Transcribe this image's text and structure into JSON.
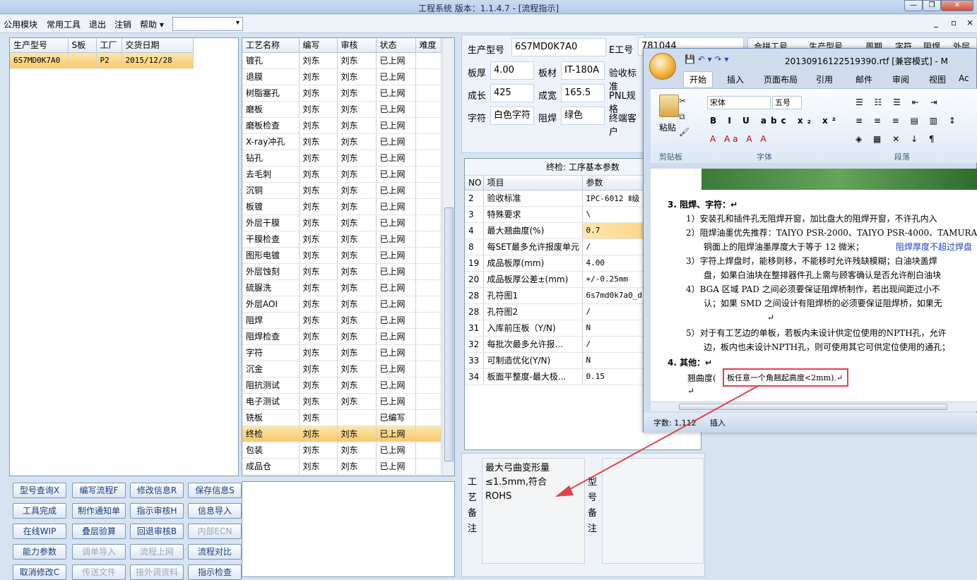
{
  "window": {
    "title": "工程系统  版本：1.1.4.7 - [流程指示]",
    "min": "—",
    "max": "❐",
    "close": "✕",
    "inner_min": "_",
    "inner_max": "▫",
    "inner_close": "×"
  },
  "menu": [
    "公用模块",
    "常用工具",
    "退出",
    "注销",
    "帮助 ▾"
  ],
  "orders": {
    "headers": [
      "生产型号",
      "S板",
      "工厂",
      "交货日期"
    ],
    "rows": [
      [
        "6S7MD0K7A0",
        "",
        "P2",
        "2015/12/28"
      ]
    ]
  },
  "process": {
    "headers": [
      "工艺名称",
      "编写",
      "审核",
      "状态",
      "难度"
    ],
    "rows": [
      [
        "镀孔",
        "刘东",
        "刘东",
        "已上网",
        ""
      ],
      [
        "退膜",
        "刘东",
        "刘东",
        "已上网",
        ""
      ],
      [
        "树脂塞孔",
        "刘东",
        "刘东",
        "已上网",
        ""
      ],
      [
        "磨板",
        "刘东",
        "刘东",
        "已上网",
        ""
      ],
      [
        "磨板检查",
        "刘东",
        "刘东",
        "已上网",
        ""
      ],
      [
        "X-ray冲孔",
        "刘东",
        "刘东",
        "已上网",
        ""
      ],
      [
        "钻孔",
        "刘东",
        "刘东",
        "已上网",
        ""
      ],
      [
        "去毛刺",
        "刘东",
        "刘东",
        "已上网",
        ""
      ],
      [
        "沉铜",
        "刘东",
        "刘东",
        "已上网",
        ""
      ],
      [
        "板镀",
        "刘东",
        "刘东",
        "已上网",
        ""
      ],
      [
        "外层干膜",
        "刘东",
        "刘东",
        "已上网",
        ""
      ],
      [
        "干膜检查",
        "刘东",
        "刘东",
        "已上网",
        ""
      ],
      [
        "图形电镀",
        "刘东",
        "刘东",
        "已上网",
        ""
      ],
      [
        "外层蚀刻",
        "刘东",
        "刘东",
        "已上网",
        ""
      ],
      [
        "硫脲洗",
        "刘东",
        "刘东",
        "已上网",
        ""
      ],
      [
        "外层AOI",
        "刘东",
        "刘东",
        "已上网",
        ""
      ],
      [
        "阻焊",
        "刘东",
        "刘东",
        "已上网",
        ""
      ],
      [
        "阻焊检查",
        "刘东",
        "刘东",
        "已上网",
        ""
      ],
      [
        "字符",
        "刘东",
        "刘东",
        "已上网",
        ""
      ],
      [
        "沉金",
        "刘东",
        "刘东",
        "已上网",
        ""
      ],
      [
        "阻抗测试",
        "刘东",
        "刘东",
        "已上网",
        ""
      ],
      [
        "电子测试",
        "刘东",
        "刘东",
        "已上网",
        ""
      ],
      [
        "铣板",
        "刘东",
        "",
        "已编写",
        ""
      ],
      [
        "终检",
        "刘东",
        "刘东",
        "已上网",
        ""
      ],
      [
        "包装",
        "刘东",
        "刘东",
        "已上网",
        ""
      ],
      [
        "成品仓",
        "刘东",
        "刘东",
        "已上网",
        ""
      ]
    ],
    "selected": 23
  },
  "buttons": [
    [
      "型号查询X",
      "编写流程F",
      "修改信息R",
      "保存信息S"
    ],
    [
      "工具完成",
      "制作通知单",
      "指示审核H",
      "信息导入"
    ],
    [
      "在线WIP",
      "叠层验算",
      "回退审核B",
      "内部ECN"
    ],
    [
      "能力参数",
      "调单导入",
      "流程上网",
      "流程对比"
    ],
    [
      "取消修改C",
      "传送文件",
      "接外调资料",
      "指示检查"
    ]
  ],
  "disabled": [
    "内部ECN",
    "调单导入",
    "流程上网",
    "传送文件",
    "接外调资料"
  ],
  "info": {
    "model_l": "生产型号",
    "model": "6S7MD0K7A0",
    "eno_l": "E工号",
    "eno": "781044",
    "thick_l": "板厚",
    "thick": "4.00",
    "mat_l": "板材",
    "mat": "IT-180A",
    "std_l": "验收标准",
    "len_l": "成长",
    "len": "425",
    "wid_l": "成宽",
    "wid": "165.5",
    "pnl_l": "PNL规格",
    "char_l": "字符",
    "char": "白色字符",
    "mask_l": "阻焊",
    "mask": "绿色",
    "cust_l": "终端客户"
  },
  "params": {
    "title": "终检: 工序基本参数",
    "headers": [
      "NO",
      "项目",
      "参数"
    ],
    "rows": [
      [
        "2",
        "验收标准",
        "IPC-6012 Ⅱ级"
      ],
      [
        "3",
        "特殊要求",
        "\\"
      ],
      [
        "4",
        "最大翘曲度(%)",
        "0.7"
      ],
      [
        "8",
        "每SET最多允许报废单元",
        "/"
      ],
      [
        "19",
        "成品板厚(mm)",
        "4.00"
      ],
      [
        "20",
        "成品板厚公差±(mm)",
        "+/-0.25mm"
      ],
      [
        "28",
        "孔符图1",
        "6s7md0k7a0_d"
      ],
      [
        "28",
        "孔符图2",
        "/"
      ],
      [
        "31",
        "入库前压板（Y/N)",
        "N"
      ],
      [
        "32",
        "每批次最多允许报...",
        "/"
      ],
      [
        "33",
        "可制造优化(Y/N)",
        "N"
      ],
      [
        "34",
        "板面平整度-最大极...",
        "0.15"
      ]
    ],
    "selected": 2
  },
  "right_grid": {
    "headers": [
      "合拼工号",
      "生产型号",
      "周期",
      "字符",
      "阻焊",
      "外层"
    ]
  },
  "remarks": {
    "proc_label": "工艺备注",
    "proc_text": "最大弓曲变形量≤1.5mm,符合ROHS",
    "model_label": "型号备注"
  },
  "word": {
    "title": "20130916122519390.rtf [兼容模式] - M",
    "tabs": [
      "开始",
      "插入",
      "页面布局",
      "引用",
      "邮件",
      "审阅",
      "视图",
      "Ac"
    ],
    "font": "宋体",
    "size": "五号",
    "paste": "粘贴",
    "groups": [
      "剪贴板",
      "字体",
      "段落"
    ],
    "lines": [
      "3.   阻焊、字符：↵",
      "1）安装孔和插件孔无阻焊开窗，加比盘大的阻焊开窗，不许孔内入",
      "2）阻焊油墨优先推荐：TAIYO PSR-2000、TAIYO PSR-4000、TAMURA",
      "铜面上的阻焊油墨厚度大于等于 12 微米；",
      "阻焊厚度不超过焊盘",
      "3）字符上焊盘时，能移则移，不能移时允许残缺模糊；白油块盖焊",
      "盘，如果白油块在整排器件孔上需与顾客确认是否允许削白油块",
      "4）BGA 区域 PAD 之间必须要保证阻焊桥制作，若出现间距过小不",
      "认；如果 SMD 之间设计有阻焊桥的必须要保证阻焊桥，如果无",
      "↵",
      "5）对于有工艺边的单板，若板内未设计供定位使用的NPTH孔，允许",
      "边，板内也未设计NPTH孔，则可使用其它可供定位使用的通孔；",
      "4.   其他：↵",
      "翘曲度(",
      "板任意一个角翘起高度<2mm).↵",
      "↵"
    ],
    "status_words": "字数: 1,112",
    "status_mode": "插入"
  },
  "colors": {
    "accent": "#f7c86b",
    "annotation": "#e0434a",
    "link": "#1f3fd0"
  }
}
